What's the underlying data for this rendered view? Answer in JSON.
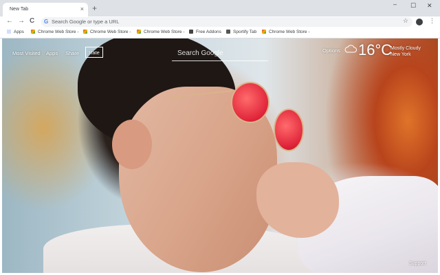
{
  "browser": {
    "tab_title": "New Tab",
    "tab_close": "×",
    "new_tab": "+",
    "window_controls": {
      "minimize": "–",
      "maximize": "☐",
      "close": "✕"
    },
    "nav": {
      "back": "←",
      "forward": "→",
      "reload": "C"
    },
    "omnibox_placeholder": "Search Google or type a URL",
    "omnibox_logo": "G",
    "bookmark_star": "☆",
    "menu": "⋮",
    "bookmarks": [
      {
        "label": "Apps",
        "icon": "apps-grid-icon"
      },
      {
        "label": "Chrome Web Store -",
        "icon": "chrome-web-store-icon"
      },
      {
        "label": "Chrome Web Store -",
        "icon": "chrome-web-store-icon"
      },
      {
        "label": "Chrome Web Store -",
        "icon": "chrome-web-store-icon"
      },
      {
        "label": "Free Addons",
        "icon": "free-addons-icon"
      },
      {
        "label": "Sportify Tab",
        "icon": "sportify-tab-icon"
      },
      {
        "label": "Chrome Web Store -",
        "icon": "chrome-web-store-icon"
      }
    ]
  },
  "ntp": {
    "links": {
      "most_visited": "Most Visited",
      "apps": "Apps",
      "share": "Share",
      "rate": "Rate"
    },
    "search_placeholder": "Search Google",
    "options": "Options",
    "weather": {
      "temperature": "16°C",
      "condition": "Mostly Cloudy",
      "location": "New York",
      "icon": "cloud-icon"
    },
    "support": "Support"
  },
  "colors": {
    "chrome_tabstrip": "#dee1e6",
    "omnibox_bg": "#f1f3f4",
    "overlay_text": "#ffffff"
  }
}
